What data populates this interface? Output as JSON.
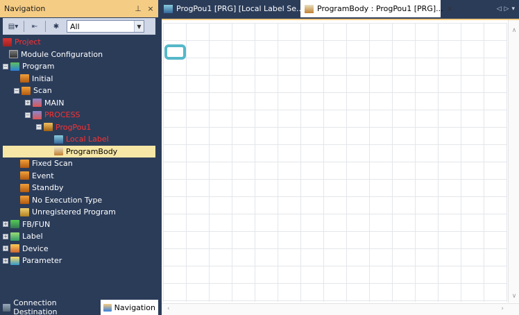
{
  "navigation": {
    "title": "Navigation",
    "pin_glyph": "⊥",
    "close_glyph": "×",
    "toolbar": {
      "filter_value": "All"
    },
    "tree": [
      {
        "label": "Project",
        "color": "red"
      },
      {
        "label": "Module Configuration"
      },
      {
        "label": "Program"
      },
      {
        "label": "Initial"
      },
      {
        "label": "Scan"
      },
      {
        "label": "MAIN"
      },
      {
        "label": "PROCESS",
        "color": "red"
      },
      {
        "label": "ProgPou1",
        "color": "red"
      },
      {
        "label": "Local Label",
        "color": "red"
      },
      {
        "label": "ProgramBody",
        "selected": true
      },
      {
        "label": "Fixed Scan"
      },
      {
        "label": "Event"
      },
      {
        "label": "Standby"
      },
      {
        "label": "No Execution Type"
      },
      {
        "label": "Unregistered Program"
      },
      {
        "label": "FB/FUN"
      },
      {
        "label": "Label"
      },
      {
        "label": "Device"
      },
      {
        "label": "Parameter"
      }
    ],
    "bottom_tabs": {
      "connection": "Connection Destination",
      "navigation": "Navigation"
    }
  },
  "editor": {
    "tabs": [
      {
        "label": "ProgPou1 [PRG] [Local Label Se..."
      },
      {
        "label": "ProgramBody : ProgPou1 [PRG]...",
        "close": "×"
      }
    ]
  },
  "colors": {
    "panel_bg": "#2b3c59",
    "header_accent": "#f5cc84",
    "selected_row": "#f7e7a7",
    "red_text": "#ff3030",
    "cursor": "#55b8c9"
  }
}
